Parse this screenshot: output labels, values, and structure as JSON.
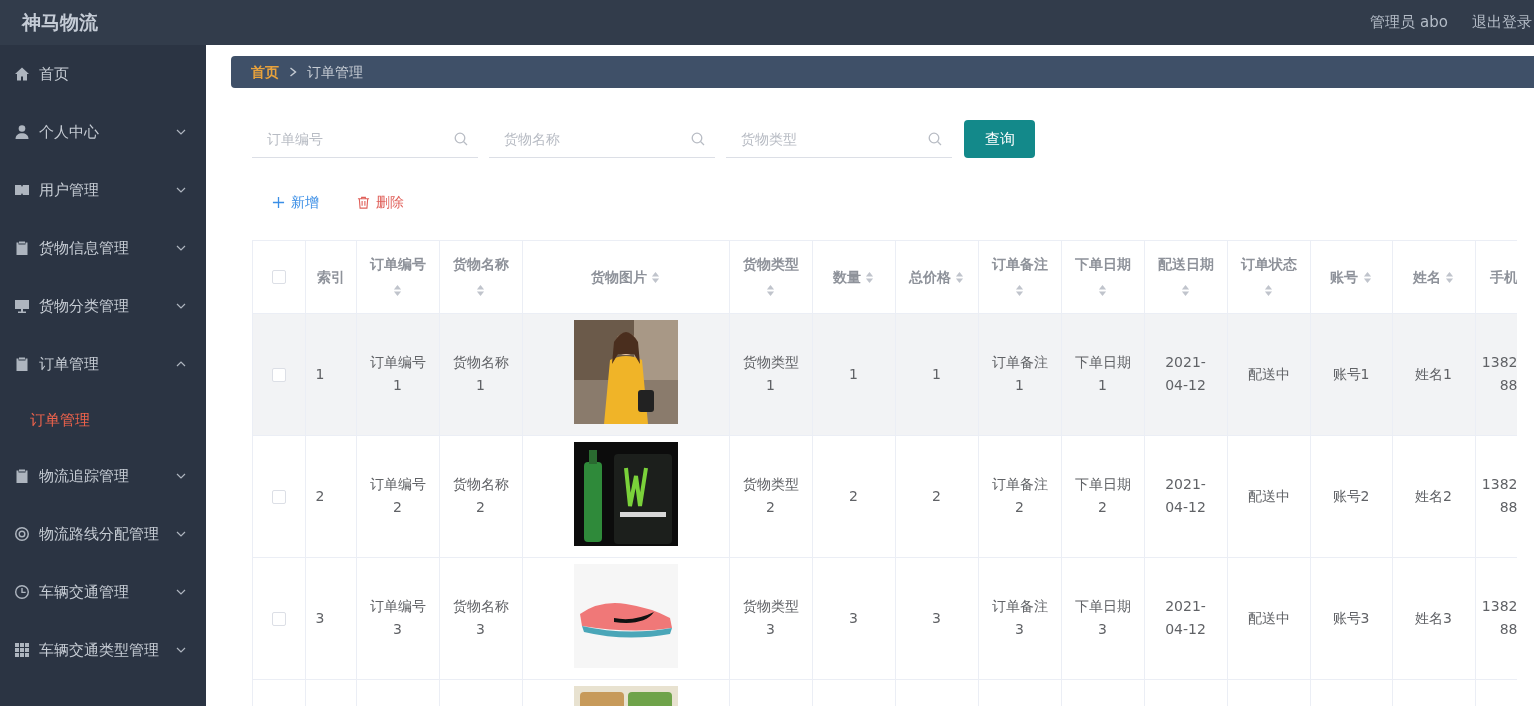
{
  "header": {
    "title": "神马物流",
    "user": "管理员 abo",
    "logout": "退出登录"
  },
  "sidebar": {
    "items": [
      {
        "label": "首页",
        "expandable": false
      },
      {
        "label": "个人中心",
        "expandable": true,
        "expanded": false
      },
      {
        "label": "用户管理",
        "expandable": true,
        "expanded": false
      },
      {
        "label": "货物信息管理",
        "expandable": true,
        "expanded": false
      },
      {
        "label": "货物分类管理",
        "expandable": true,
        "expanded": false
      },
      {
        "label": "订单管理",
        "expandable": true,
        "expanded": true,
        "children": [
          {
            "label": "订单管理",
            "selected": true
          }
        ]
      },
      {
        "label": "物流追踪管理",
        "expandable": true,
        "expanded": false
      },
      {
        "label": "物流路线分配管理",
        "expandable": true,
        "expanded": false
      },
      {
        "label": "车辆交通管理",
        "expandable": true,
        "expanded": false
      },
      {
        "label": "车辆交通类型管理",
        "expandable": true,
        "expanded": false
      }
    ]
  },
  "breadcrumb": [
    "首页",
    "订单管理"
  ],
  "search": {
    "fields": [
      {
        "placeholder": "订单编号"
      },
      {
        "placeholder": "货物名称"
      },
      {
        "placeholder": "货物类型"
      }
    ],
    "button": "查询"
  },
  "actions": [
    {
      "kind": "add",
      "label": "新增"
    },
    {
      "kind": "delete",
      "label": "删除"
    }
  ],
  "table": {
    "select_all": {
      "checked": false
    },
    "columns": [
      {
        "label": "索引",
        "sortable": false
      },
      {
        "label": "订单编号",
        "sortable": true
      },
      {
        "label": "货物名称",
        "sortable": true
      },
      {
        "label": "货物图片",
        "sortable": true
      },
      {
        "label": "货物类型",
        "sortable": true
      },
      {
        "label": "数量",
        "sortable": true
      },
      {
        "label": "总价格",
        "sortable": true
      },
      {
        "label": "订单备注",
        "sortable": true
      },
      {
        "label": "下单日期",
        "sortable": true
      },
      {
        "label": "配送日期",
        "sortable": true
      },
      {
        "label": "订单状态",
        "sortable": true
      },
      {
        "label": "账号",
        "sortable": true
      },
      {
        "label": "姓名",
        "sortable": true
      },
      {
        "label": "手机",
        "sortable": false
      }
    ],
    "rows": [
      {
        "checked": false,
        "highlighted": true,
        "image": {
          "kind": "picture"
        },
        "cells": [
          "1",
          "订单编号1",
          "货物名称1",
          null,
          "货物类型1",
          "1",
          "1",
          "订单备注1",
          "下单日期1",
          "2021-04-12",
          "配送中",
          "账号1",
          "姓名1",
          "1382\n88"
        ]
      },
      {
        "checked": false,
        "highlighted": false,
        "image": {
          "kind": "picture"
        },
        "cells": [
          "2",
          "订单编号2",
          "货物名称2",
          null,
          "货物类型2",
          "2",
          "2",
          "订单备注2",
          "下单日期2",
          "2021-04-12",
          "配送中",
          "账号2",
          "姓名2",
          "1382\n88"
        ]
      },
      {
        "checked": false,
        "highlighted": false,
        "image": {
          "kind": "picture"
        },
        "cells": [
          "3",
          "订单编号3",
          "货物名称3",
          null,
          "货物类型3",
          "3",
          "3",
          "订单备注3",
          "下单日期3",
          "2021-04-12",
          "配送中",
          "账号3",
          "姓名3",
          "1382\n88"
        ]
      },
      {
        "image": {
          "kind": "picture"
        }
      }
    ]
  }
}
